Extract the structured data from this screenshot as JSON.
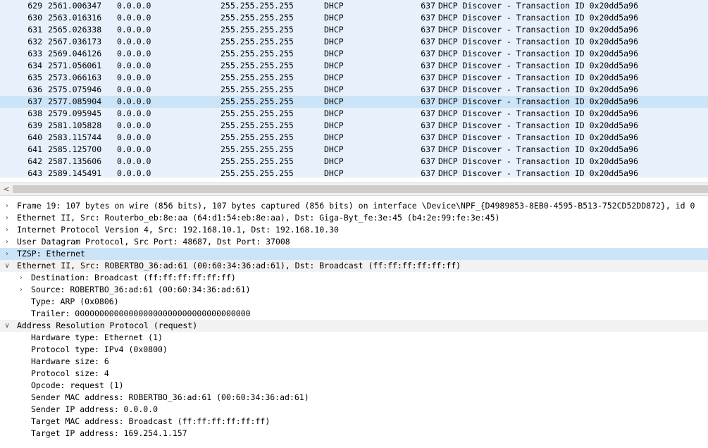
{
  "packet_list": {
    "selected_index": 8,
    "rows": [
      {
        "no": "629",
        "time": "2561.006347",
        "src": "0.0.0.0",
        "dst": "255.255.255.255",
        "proto": "DHCP",
        "len": "637",
        "info": "DHCP Discover - Transaction ID 0x20dd5a96"
      },
      {
        "no": "630",
        "time": "2563.016316",
        "src": "0.0.0.0",
        "dst": "255.255.255.255",
        "proto": "DHCP",
        "len": "637",
        "info": "DHCP Discover - Transaction ID 0x20dd5a96"
      },
      {
        "no": "631",
        "time": "2565.026338",
        "src": "0.0.0.0",
        "dst": "255.255.255.255",
        "proto": "DHCP",
        "len": "637",
        "info": "DHCP Discover - Transaction ID 0x20dd5a96"
      },
      {
        "no": "632",
        "time": "2567.036173",
        "src": "0.0.0.0",
        "dst": "255.255.255.255",
        "proto": "DHCP",
        "len": "637",
        "info": "DHCP Discover - Transaction ID 0x20dd5a96"
      },
      {
        "no": "633",
        "time": "2569.046126",
        "src": "0.0.0.0",
        "dst": "255.255.255.255",
        "proto": "DHCP",
        "len": "637",
        "info": "DHCP Discover - Transaction ID 0x20dd5a96"
      },
      {
        "no": "634",
        "time": "2571.056061",
        "src": "0.0.0.0",
        "dst": "255.255.255.255",
        "proto": "DHCP",
        "len": "637",
        "info": "DHCP Discover - Transaction ID 0x20dd5a96"
      },
      {
        "no": "635",
        "time": "2573.066163",
        "src": "0.0.0.0",
        "dst": "255.255.255.255",
        "proto": "DHCP",
        "len": "637",
        "info": "DHCP Discover - Transaction ID 0x20dd5a96"
      },
      {
        "no": "636",
        "time": "2575.075946",
        "src": "0.0.0.0",
        "dst": "255.255.255.255",
        "proto": "DHCP",
        "len": "637",
        "info": "DHCP Discover - Transaction ID 0x20dd5a96"
      },
      {
        "no": "637",
        "time": "2577.085904",
        "src": "0.0.0.0",
        "dst": "255.255.255.255",
        "proto": "DHCP",
        "len": "637",
        "info": "DHCP Discover - Transaction ID 0x20dd5a96"
      },
      {
        "no": "638",
        "time": "2579.095945",
        "src": "0.0.0.0",
        "dst": "255.255.255.255",
        "proto": "DHCP",
        "len": "637",
        "info": "DHCP Discover - Transaction ID 0x20dd5a96"
      },
      {
        "no": "639",
        "time": "2581.105828",
        "src": "0.0.0.0",
        "dst": "255.255.255.255",
        "proto": "DHCP",
        "len": "637",
        "info": "DHCP Discover - Transaction ID 0x20dd5a96"
      },
      {
        "no": "640",
        "time": "2583.115744",
        "src": "0.0.0.0",
        "dst": "255.255.255.255",
        "proto": "DHCP",
        "len": "637",
        "info": "DHCP Discover - Transaction ID 0x20dd5a96"
      },
      {
        "no": "641",
        "time": "2585.125700",
        "src": "0.0.0.0",
        "dst": "255.255.255.255",
        "proto": "DHCP",
        "len": "637",
        "info": "DHCP Discover - Transaction ID 0x20dd5a96"
      },
      {
        "no": "642",
        "time": "2587.135606",
        "src": "0.0.0.0",
        "dst": "255.255.255.255",
        "proto": "DHCP",
        "len": "637",
        "info": "DHCP Discover - Transaction ID 0x20dd5a96"
      },
      {
        "no": "643",
        "time": "2589.145491",
        "src": "0.0.0.0",
        "dst": "255.255.255.255",
        "proto": "DHCP",
        "len": "637",
        "info": "DHCP Discover - Transaction ID 0x20dd5a96"
      }
    ]
  },
  "scrollbar": {
    "left_arrow": "<"
  },
  "detail": {
    "items": [
      {
        "level": 0,
        "state": "collapsed",
        "highlight": false,
        "text": "Frame 19: 107 bytes on wire (856 bits), 107 bytes captured (856 bits) on interface \\Device\\NPF_{D4989853-8EB0-4595-B513-752CD52DD872}, id 0"
      },
      {
        "level": 0,
        "state": "collapsed",
        "highlight": false,
        "text": "Ethernet II, Src: Routerbo_eb:8e:aa (64:d1:54:eb:8e:aa), Dst: Giga-Byt_fe:3e:45 (b4:2e:99:fe:3e:45)"
      },
      {
        "level": 0,
        "state": "collapsed",
        "highlight": false,
        "text": "Internet Protocol Version 4, Src: 192.168.10.1, Dst: 192.168.10.30"
      },
      {
        "level": 0,
        "state": "collapsed",
        "highlight": false,
        "text": "User Datagram Protocol, Src Port: 48687, Dst Port: 37008"
      },
      {
        "level": 0,
        "state": "collapsed",
        "highlight": true,
        "text": "TZSP: Ethernet"
      },
      {
        "level": 0,
        "state": "expanded",
        "highlight": false,
        "text": "Ethernet II, Src: ROBERTBO_36:ad:61 (00:60:34:36:ad:61), Dst: Broadcast (ff:ff:ff:ff:ff:ff)"
      },
      {
        "level": 1,
        "state": "collapsed",
        "highlight": false,
        "text": "Destination: Broadcast (ff:ff:ff:ff:ff:ff)"
      },
      {
        "level": 1,
        "state": "collapsed",
        "highlight": false,
        "text": "Source: ROBERTBO_36:ad:61 (00:60:34:36:ad:61)"
      },
      {
        "level": 1,
        "state": "leaf",
        "highlight": false,
        "text": "Type: ARP (0x0806)"
      },
      {
        "level": 1,
        "state": "leaf",
        "highlight": false,
        "text": "Trailer: 000000000000000000000000000000000000"
      },
      {
        "level": 0,
        "state": "expanded",
        "highlight": false,
        "text": "Address Resolution Protocol (request)"
      },
      {
        "level": 1,
        "state": "leaf",
        "highlight": false,
        "text": "Hardware type: Ethernet (1)"
      },
      {
        "level": 1,
        "state": "leaf",
        "highlight": false,
        "text": "Protocol type: IPv4 (0x0800)"
      },
      {
        "level": 1,
        "state": "leaf",
        "highlight": false,
        "text": "Hardware size: 6"
      },
      {
        "level": 1,
        "state": "leaf",
        "highlight": false,
        "text": "Protocol size: 4"
      },
      {
        "level": 1,
        "state": "leaf",
        "highlight": false,
        "text": "Opcode: request (1)"
      },
      {
        "level": 1,
        "state": "leaf",
        "highlight": false,
        "text": "Sender MAC address: ROBERTBO_36:ad:61 (00:60:34:36:ad:61)"
      },
      {
        "level": 1,
        "state": "leaf",
        "highlight": false,
        "text": "Sender IP address: 0.0.0.0"
      },
      {
        "level": 1,
        "state": "leaf",
        "highlight": false,
        "text": "Target MAC address: Broadcast (ff:ff:ff:ff:ff:ff)"
      },
      {
        "level": 1,
        "state": "leaf",
        "highlight": false,
        "text": "Target IP address: 169.254.1.157"
      }
    ]
  },
  "icons": {
    "collapsed": "chevron-right-icon",
    "expanded": "chevron-down-icon",
    "scroll_left": "chevron-left-icon"
  },
  "colors": {
    "list_bg": "#e7f1fb",
    "selection": "#cce4f7",
    "expanded_bg": "#f2f2f2"
  }
}
